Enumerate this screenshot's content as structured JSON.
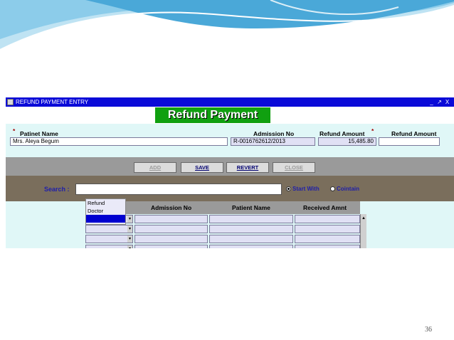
{
  "colors": {
    "titlebar": "#0a0ad8",
    "heading_bg": "#10a010",
    "form_bg": "#e0f7f7",
    "search_bar": "#7a6e5c",
    "button_bar": "#9a9a9a",
    "wave": "#4aa8d8"
  },
  "window": {
    "title": "REFUND PAYMENT ENTRY",
    "controls": [
      "_",
      "↗",
      "X"
    ]
  },
  "form": {
    "heading": "Refund Payment",
    "required_mark": "*",
    "patient_name_label": "Patinet Name",
    "patient_name_value": "Mrs. Aleya Begum",
    "admission_no_label": "Admission No",
    "admission_no_value": "R-0016762612/2013",
    "refund_amount_label": "Refund Amount",
    "refund_amount_value": "15,485.80",
    "refund_amount2_label": "Refund Amount",
    "refund_amount2_value": ""
  },
  "toolbar": {
    "add_label": "ADD",
    "save_label": "SAVE",
    "revert_label": "REVERT",
    "close_label": "CLOSE"
  },
  "search": {
    "label": "Search :",
    "value": "",
    "options": [
      {
        "label": "Start With",
        "selected": true
      },
      {
        "label": "Cointain",
        "selected": false
      }
    ]
  },
  "dropdown": {
    "options": [
      "Refund",
      "Doctor"
    ],
    "selected_index": 2
  },
  "grid": {
    "columns": [
      "Admission No",
      "Patient Name",
      "Received Amnt"
    ],
    "rows": 4
  },
  "page_number": "36"
}
